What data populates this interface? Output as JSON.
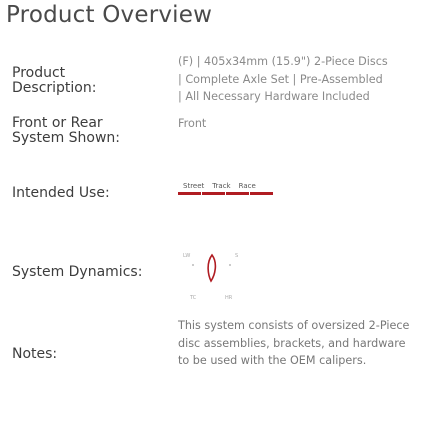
{
  "page": {
    "title": "Product Overview"
  },
  "labels": {
    "description": "Product Description:",
    "front_rear": "Front or Rear System Shown:",
    "intended_use": "Intended Use:",
    "dynamics": "System Dynamics:",
    "notes": "Notes:"
  },
  "values": {
    "description_lines": [
      "(F) | 405x34mm (15.9\") 2-Piece Discs",
      "| Complete Axle Set | Pre-Assembled",
      "| All Necessary Hardware Included"
    ],
    "front_rear": "Front",
    "notes": "This system consists of oversized 2-Piece disc assemblies, brackets, and hardware to be used with the OEM calipers."
  },
  "intended_use": {
    "categories": [
      "Street",
      "Track",
      "Race"
    ],
    "levels": [
      1,
      1,
      1,
      1
    ]
  },
  "dynamics": {
    "axis_labels": [
      "LW",
      "S",
      "TC",
      "HR"
    ]
  },
  "colors": {
    "accent": "#b01c22",
    "label": "#3d3d3d",
    "value": "#8a8a8a"
  }
}
